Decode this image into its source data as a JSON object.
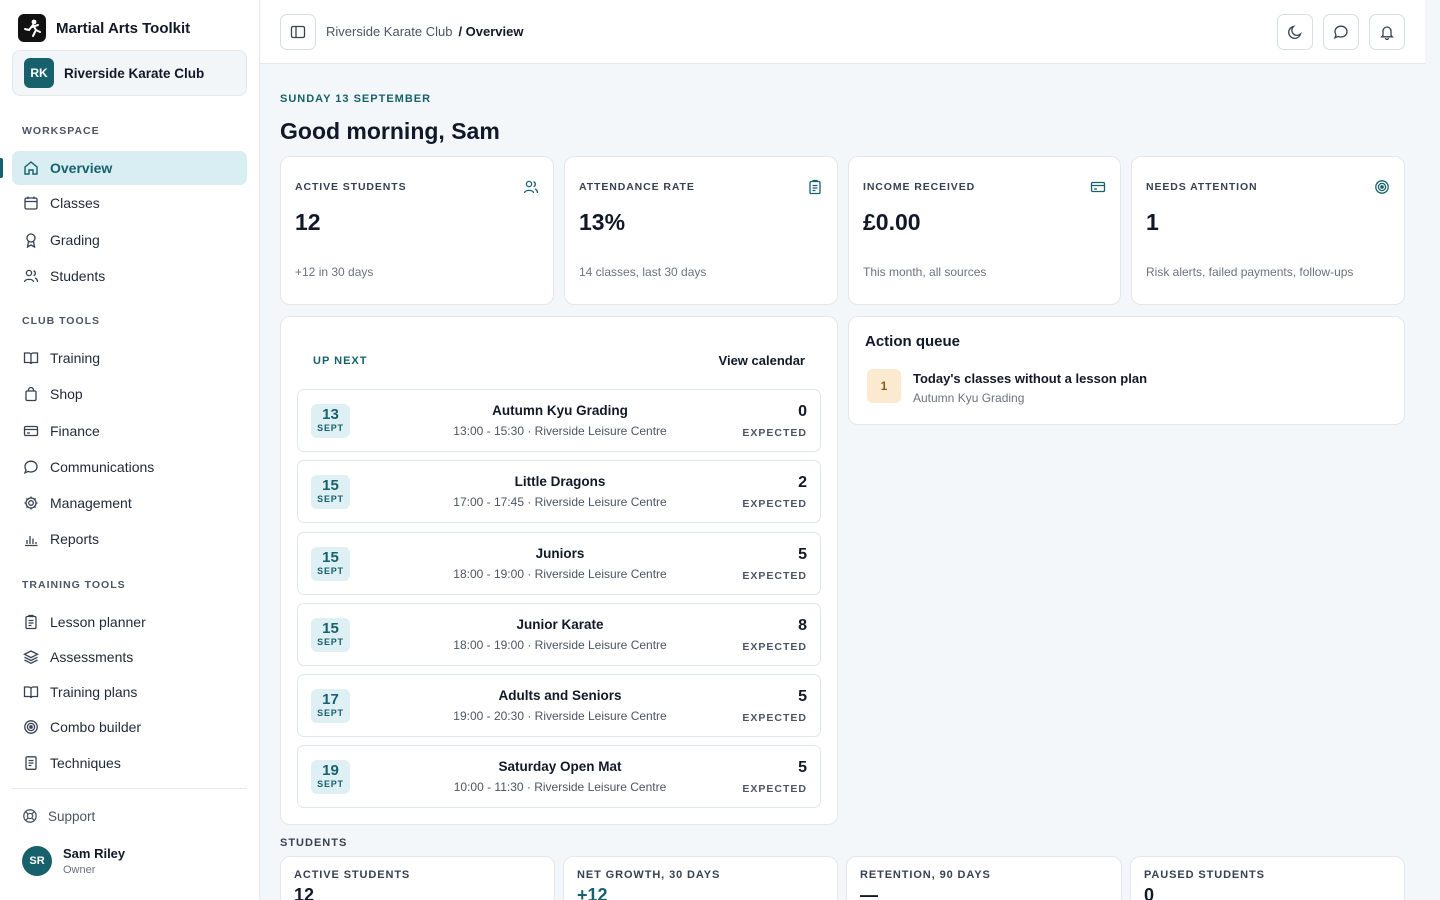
{
  "app": {
    "title": "Martial Arts Toolkit"
  },
  "club": {
    "initials": "RK",
    "name": "Riverside Karate Club"
  },
  "sidebar": {
    "workspace_label": "WORKSPACE",
    "workspace_items": [
      {
        "label": "Overview",
        "icon": "home-icon",
        "active": true
      },
      {
        "label": "Classes",
        "icon": "calendar-icon"
      },
      {
        "label": "Grading",
        "icon": "award-icon"
      },
      {
        "label": "Students",
        "icon": "users-icon"
      }
    ],
    "club_tools_label": "CLUB TOOLS",
    "club_tools_items": [
      {
        "label": "Training",
        "icon": "book-icon"
      },
      {
        "label": "Shop",
        "icon": "bag-icon"
      },
      {
        "label": "Finance",
        "icon": "credit-card-icon"
      },
      {
        "label": "Communications",
        "icon": "chat-icon"
      },
      {
        "label": "Management",
        "icon": "gear-icon"
      },
      {
        "label": "Reports",
        "icon": "bar-chart-icon"
      }
    ],
    "training_tools_label": "TRAINING TOOLS",
    "training_tools_items": [
      {
        "label": "Lesson planner",
        "icon": "clipboard-icon"
      },
      {
        "label": "Assessments",
        "icon": "layers-icon"
      },
      {
        "label": "Training plans",
        "icon": "book-icon"
      },
      {
        "label": "Combo builder",
        "icon": "target-icon"
      },
      {
        "label": "Techniques",
        "icon": "document-icon"
      }
    ],
    "support_label": "Support",
    "user": {
      "initials": "SR",
      "name": "Sam Riley",
      "role": "Owner"
    }
  },
  "topbar": {
    "breadcrumb": [
      "Riverside Karate Club",
      "/ Overview"
    ],
    "icons": [
      "sidebar-toggle-icon",
      "moon-icon",
      "chat-icon",
      "bell-icon"
    ]
  },
  "main": {
    "date_label": "SUNDAY 13 SEPTEMBER",
    "greeting": "Good morning, Sam",
    "kpis": [
      {
        "label": "ACTIVE STUDENTS",
        "value": "12",
        "sub": "+12 in 30 days",
        "icon": "users-icon"
      },
      {
        "label": "ATTENDANCE RATE",
        "value": "13%",
        "sub": "14 classes, last 30 days",
        "icon": "clipboard-icon"
      },
      {
        "label": "INCOME RECEIVED",
        "value": "£0.00",
        "sub": "This month, all sources",
        "icon": "credit-card-icon"
      },
      {
        "label": "NEEDS ATTENTION",
        "value": "1",
        "sub": "Risk alerts, failed payments, follow-ups",
        "icon": "target-icon"
      }
    ],
    "up_next": {
      "title": "UP NEXT",
      "view_calendar": "View calendar",
      "expected_label": "EXPECTED",
      "classes": [
        {
          "day": "13",
          "month": "SEPT",
          "name": "Autumn Kyu Grading",
          "meta": "13:00 - 15:30 · Riverside Leisure Centre",
          "expected": "0"
        },
        {
          "day": "15",
          "month": "SEPT",
          "name": "Little Dragons",
          "meta": "17:00 - 17:45 · Riverside Leisure Centre",
          "expected": "2"
        },
        {
          "day": "15",
          "month": "SEPT",
          "name": "Juniors",
          "meta": "18:00 - 19:00 · Riverside Leisure Centre",
          "expected": "5"
        },
        {
          "day": "15",
          "month": "SEPT",
          "name": "Junior Karate",
          "meta": "18:00 - 19:00 · Riverside Leisure Centre",
          "expected": "8"
        },
        {
          "day": "17",
          "month": "SEPT",
          "name": "Adults and Seniors",
          "meta": "19:00 - 20:30 · Riverside Leisure Centre",
          "expected": "5"
        },
        {
          "day": "19",
          "month": "SEPT",
          "name": "Saturday Open Mat",
          "meta": "10:00 - 11:30 · Riverside Leisure Centre",
          "expected": "5"
        }
      ]
    },
    "action_queue": {
      "title": "Action queue",
      "items": [
        {
          "count": "1",
          "title": "Today's classes without a lesson plan",
          "sub": "Autumn Kyu Grading"
        }
      ]
    },
    "students": {
      "label": "STUDENTS",
      "kpis": [
        {
          "label": "ACTIVE STUDENTS",
          "value": "12"
        },
        {
          "label": "NET GROWTH, 30 DAYS",
          "value": "+12"
        },
        {
          "label": "RETENTION, 90 DAYS",
          "value": "—"
        },
        {
          "label": "PAUSED STUDENTS",
          "value": "0"
        }
      ]
    }
  },
  "colors": {
    "accent": "#17616c",
    "accent_soft": "#d8eef3",
    "warning_soft": "#fbe9d0"
  }
}
